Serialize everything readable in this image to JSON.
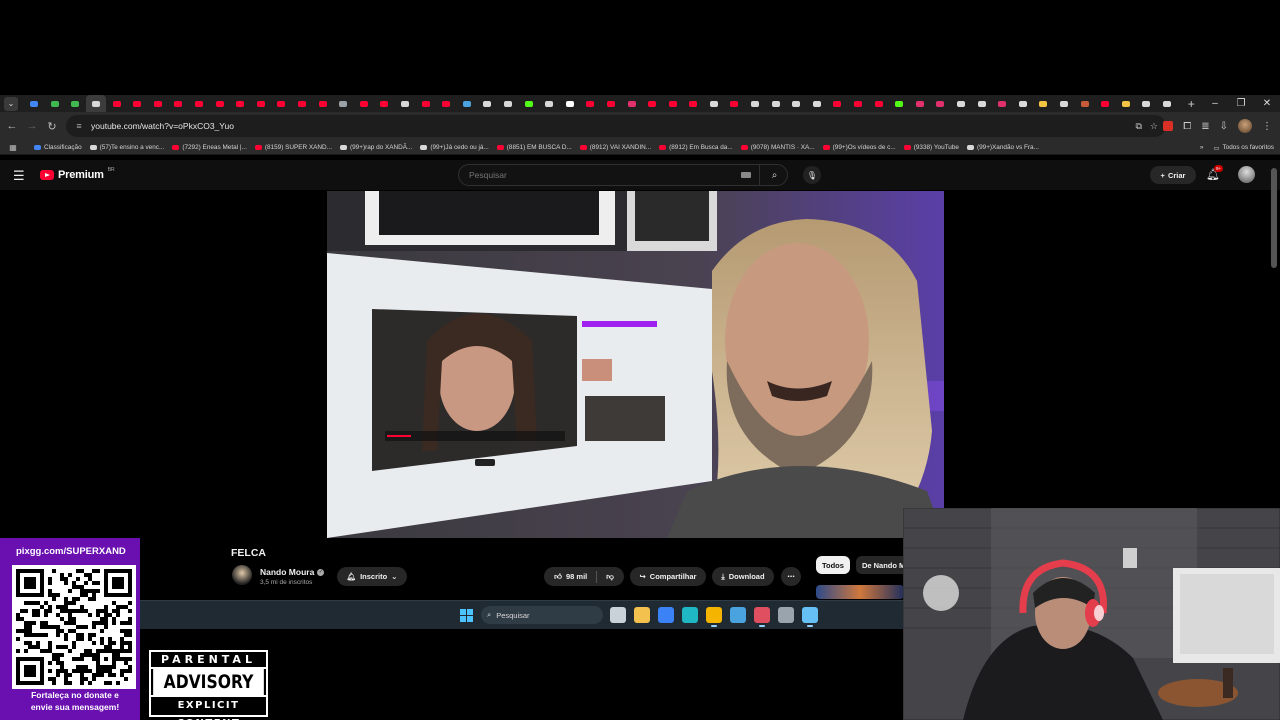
{
  "browser": {
    "tab_count": 56,
    "tab_favicon_colors": [
      "#4285f4",
      "#3fb950",
      "#3fb950",
      "#d8d8d8",
      "#ff0033",
      "#ff0033",
      "#ff0033",
      "#ff0033",
      "#ff0033",
      "#ff0033",
      "#ff0033",
      "#ff0033",
      "#ff0033",
      "#ff0033",
      "#ff0033",
      "#9aa0a6",
      "#ff0033",
      "#ff0033",
      "#d8d8d8",
      "#ff0033",
      "#ff0033",
      "#4aa3df",
      "#d8d8d8",
      "#d8d8d8",
      "#53fc18",
      "#d8d8d8",
      "#ffffff",
      "#ff0033",
      "#ff0033",
      "#e1306c",
      "#ff0033",
      "#ff0033",
      "#ff0033",
      "#d8d8d8",
      "#ff0033",
      "#d8d8d8",
      "#d8d8d8",
      "#d8d8d8",
      "#d8d8d8",
      "#ff0033",
      "#ff0033",
      "#ff0033",
      "#53fc18",
      "#e1306c",
      "#e1306c",
      "#d8d8d8",
      "#d8d8d8",
      "#e1306c",
      "#d8d8d8",
      "#f4c542",
      "#d8d8d8",
      "#c75b39",
      "#ff0033",
      "#f4c542",
      "#d8d8d8",
      "#d8d8d8"
    ],
    "active_tab_index": 3,
    "url": "youtube.com/watch?v=oPkxCO3_Yuo",
    "bookmarks": [
      {
        "label": "Classificação",
        "color": "#4285f4"
      },
      {
        "label": "(57)Te ensino a venc...",
        "color": "#d8d8d8"
      },
      {
        "label": "(7292) Eneas Metal |...",
        "color": "#ff0033"
      },
      {
        "label": "(8159) SUPER XAND...",
        "color": "#ff0033"
      },
      {
        "label": "(99+)rap do XANDÃ...",
        "color": "#d8d8d8"
      },
      {
        "label": "(99+)Já cedo ou já...",
        "color": "#d8d8d8"
      },
      {
        "label": "(8851) EM BUSCA D...",
        "color": "#ff0033"
      },
      {
        "label": "(8912) VAI XANDIN...",
        "color": "#ff0033"
      },
      {
        "label": "(8912) Em Busca da...",
        "color": "#ff0033"
      },
      {
        "label": "(9078) MANTIS · XA...",
        "color": "#ff0033"
      },
      {
        "label": "(99+)Os vídeos de c...",
        "color": "#ff0033"
      },
      {
        "label": "(9338) YouTube",
        "color": "#ff0033"
      },
      {
        "label": "(99+)Xandão vs Fra...",
        "color": "#d8d8d8"
      }
    ],
    "all_bookmarks_label": "Todos os favoritos"
  },
  "youtube": {
    "logo_text": "Premium",
    "region": "BR",
    "search_placeholder": "Pesquisar",
    "create_label": "Criar",
    "notifications_badge": "9+",
    "video_title": "FELCA",
    "channel_name": "Nando Moura",
    "subscribers": "3,5 mi de inscritos",
    "subscribe_state": "Inscrito",
    "likes": "98 mil",
    "share_label": "Compartilhar",
    "download_label": "Download",
    "chips": [
      "Todos",
      "De Nando M"
    ]
  },
  "taskbar": {
    "search_placeholder": "Pesquisar",
    "app_icons": [
      {
        "name": "task-view-icon",
        "color": "#c9d1d9",
        "active": false
      },
      {
        "name": "file-explorer-icon",
        "color": "#f2c14e",
        "active": false
      },
      {
        "name": "store-icon",
        "color": "#3b82f6",
        "active": false
      },
      {
        "name": "edge-icon",
        "color": "#1fb7c4",
        "active": false
      },
      {
        "name": "chrome-icon",
        "color": "#f4b400",
        "active": true
      },
      {
        "name": "photos-icon",
        "color": "#4aa3df",
        "active": false
      },
      {
        "name": "obs-icon",
        "color": "#e04f5f",
        "active": true
      },
      {
        "name": "settings-icon",
        "color": "#9aa4ad",
        "active": false
      },
      {
        "name": "steam-icon",
        "color": "#66c0f4",
        "active": true
      }
    ]
  },
  "overlays": {
    "donate_url": "pixgg.com/SUPERXAND",
    "donate_message_line1": "Fortaleça no donate e",
    "donate_message_line2": "envie sua mensagem!",
    "donate_color": "#6a0fb0",
    "parental_top": "PARENTAL",
    "parental_mid": "ADVISORY",
    "parental_bottom": "EXPLICIT CONTENT"
  },
  "colors": {
    "youtube_red": "#ff0033",
    "yt_background": "#0f0f0f",
    "chrome_toolbar": "#2b2b2b"
  }
}
